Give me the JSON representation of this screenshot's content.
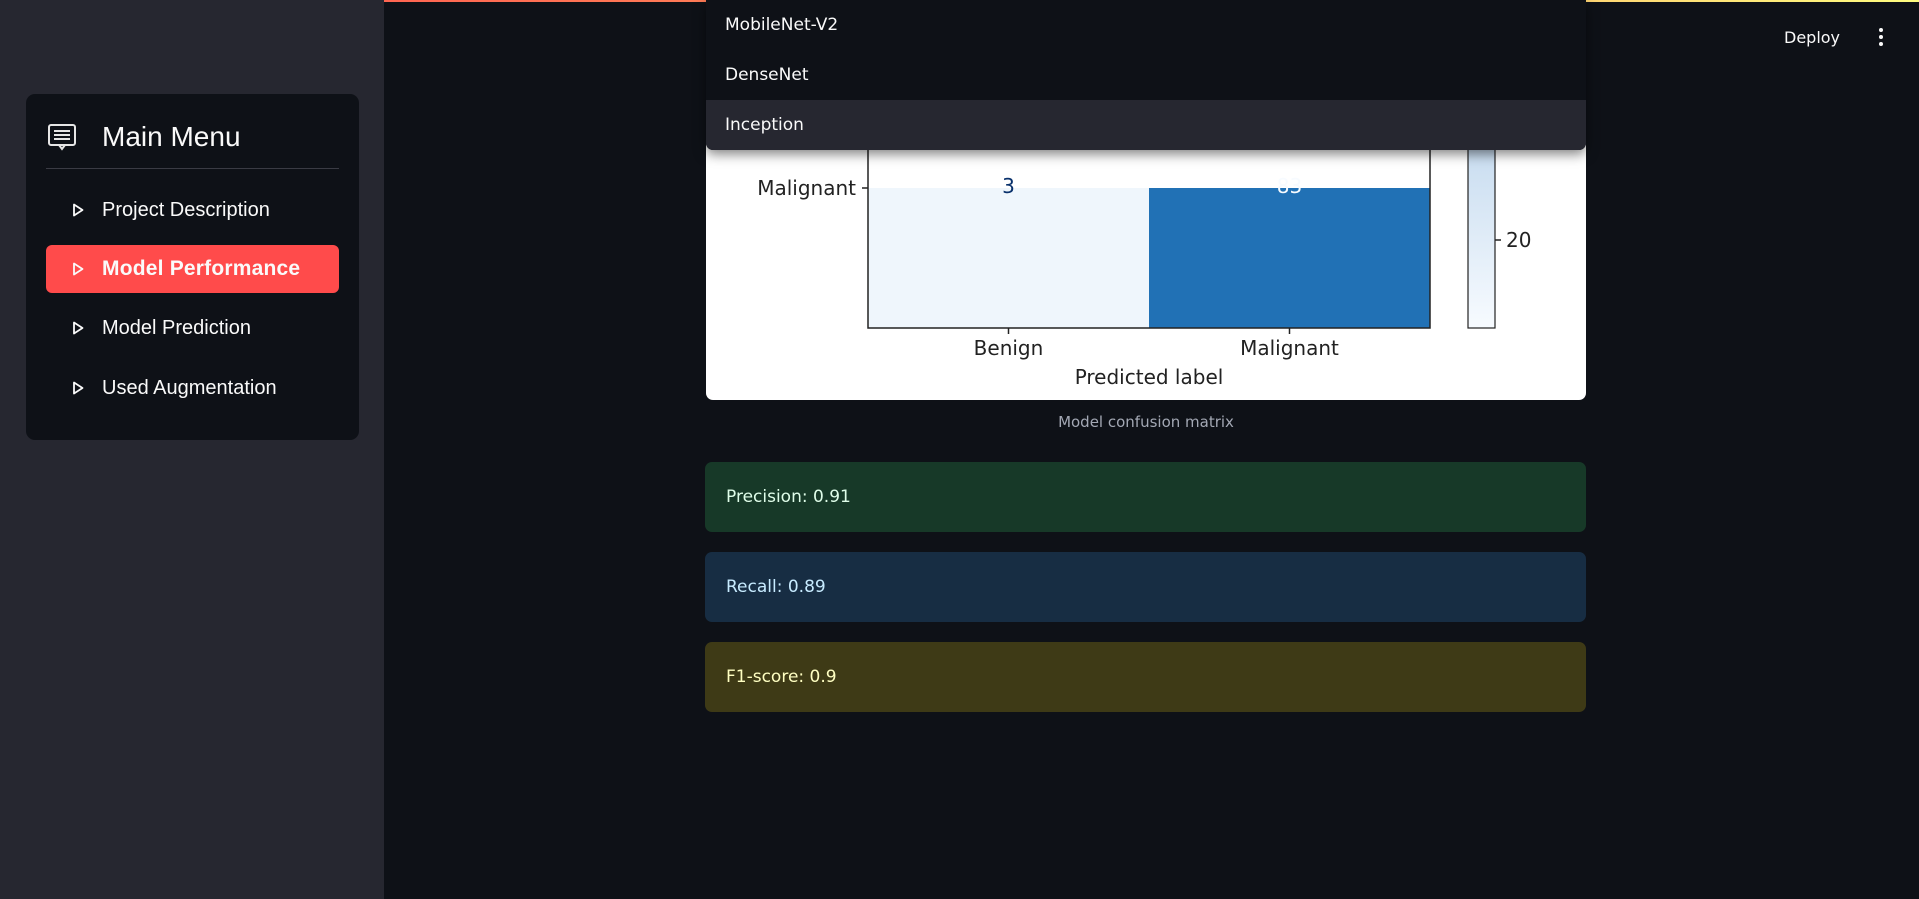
{
  "header": {
    "deploy_label": "Deploy",
    "menu_icon": "kebab-menu-icon"
  },
  "sidebar": {
    "title": "Main Menu",
    "title_icon": "menu-list-icon",
    "items": [
      {
        "label": "Project Description",
        "icon": "triangle-right-icon",
        "active": false
      },
      {
        "label": "Model Performance",
        "icon": "triangle-right-icon",
        "active": true
      },
      {
        "label": "Model Prediction",
        "icon": "triangle-right-icon",
        "active": false
      },
      {
        "label": "Used Augmentation",
        "icon": "triangle-right-icon",
        "active": false
      }
    ],
    "active_color": "#ff4b4b"
  },
  "dropdown": {
    "options": [
      "MobileNet-V2",
      "DenseNet",
      "Inception"
    ],
    "highlighted": "Inception"
  },
  "chart_data": {
    "type": "heatmap",
    "title": "",
    "xlabel": "Predicted label",
    "ylabel": "",
    "x_categories": [
      "Benign",
      "Malignant"
    ],
    "y_categories": [
      "Malignant"
    ],
    "cells": [
      {
        "row": "Malignant",
        "col": "Benign",
        "value": 3
      },
      {
        "row": "Malignant",
        "col": "Malignant",
        "value": 83
      }
    ],
    "colorbar_ticks": [
      "20"
    ],
    "colormap": "Blues"
  },
  "caption": "Model confusion matrix",
  "metrics": {
    "precision": "Precision: 0.91",
    "recall": "Recall: 0.89",
    "f1": "F1-score: 0.9"
  }
}
